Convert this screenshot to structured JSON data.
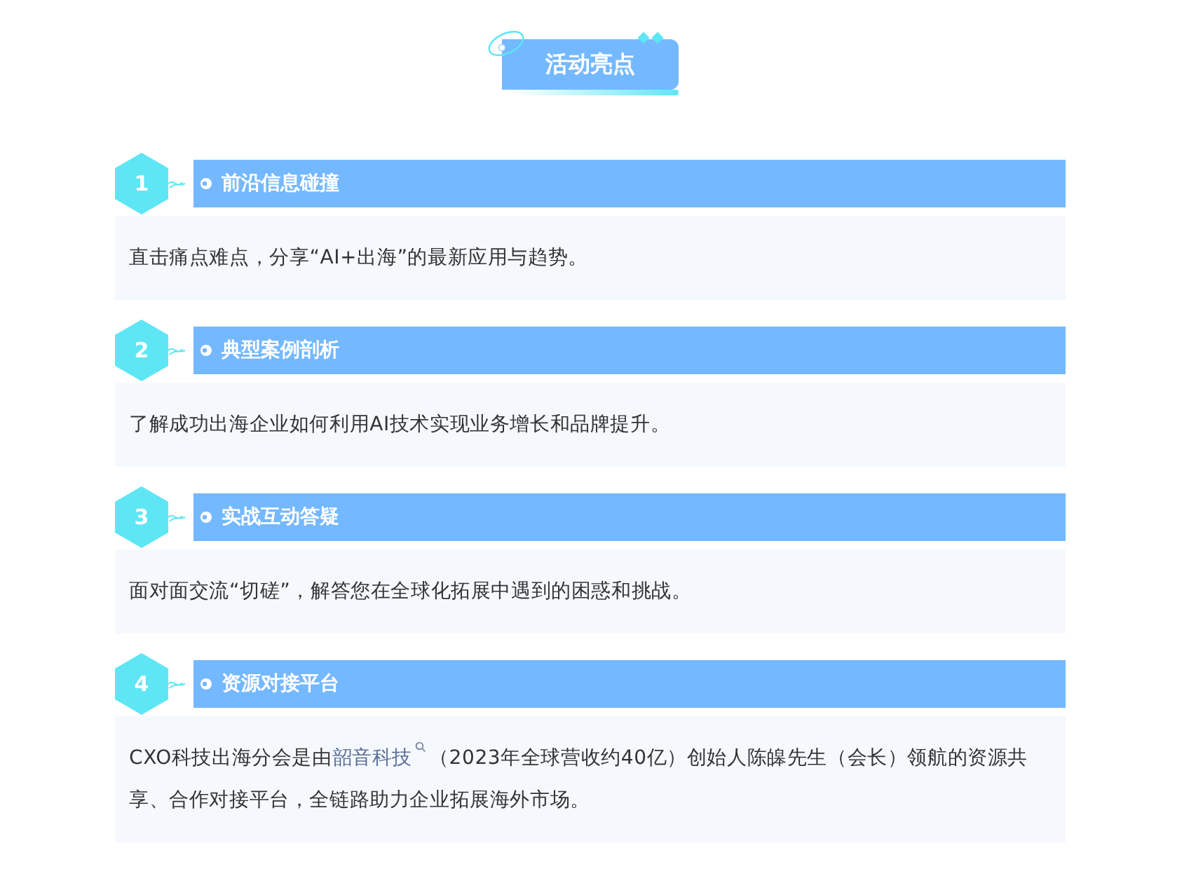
{
  "title": "活动亮点",
  "sections": [
    {
      "number": "1",
      "heading": "前沿信息碰撞",
      "description": [
        {
          "kind": "text",
          "text": "直击痛点难点，分享“AI+出海”的最新应用与趋势。"
        }
      ]
    },
    {
      "number": "2",
      "heading": "典型案例剖析",
      "description": [
        {
          "kind": "text",
          "text": "了解成功出海企业如何利用AI技术实现业务增长和品牌提升。"
        }
      ]
    },
    {
      "number": "3",
      "heading": "实战互动答疑",
      "description": [
        {
          "kind": "text",
          "text": "面对面交流“切磋”，解答您在全球化拓展中遇到的困惑和挑战。"
        }
      ]
    },
    {
      "number": "4",
      "heading": "资源对接平台",
      "description": [
        {
          "kind": "text",
          "text": "CXO科技出海分会是由"
        },
        {
          "kind": "link",
          "text": "韶音科技"
        },
        {
          "kind": "text",
          "text": "（2023年全球营收约40亿）创始人陈皞先生（会长）领航的资源共享、合作对接平台，全链路助力企业拓展海外市场。"
        }
      ]
    }
  ]
}
